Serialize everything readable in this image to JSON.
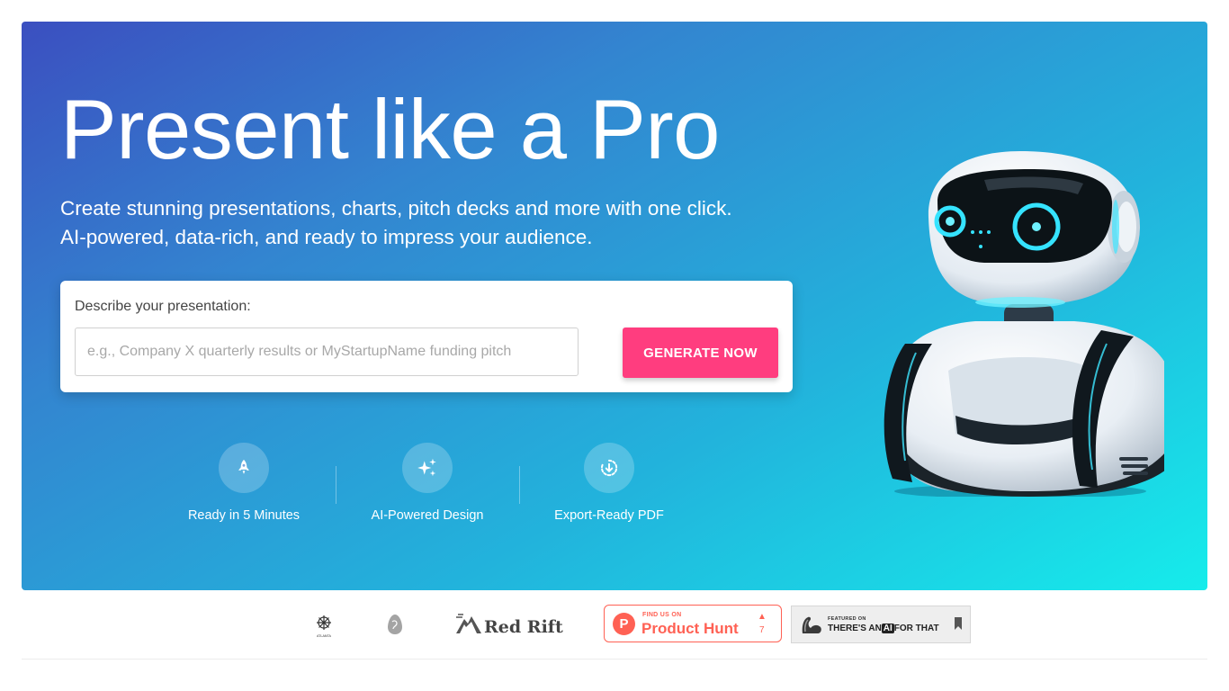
{
  "hero": {
    "title": "Present like a Pro",
    "subtitle_line1": "Create stunning presentations, charts, pitch decks and more with one click.",
    "subtitle_line2": "AI-powered, data-rich, and ready to impress your audience."
  },
  "form": {
    "label": "Describe your presentation:",
    "input_value": "",
    "input_placeholder": "e.g., Company X quarterly results or MyStartupName funding pitch",
    "button_label": "GENERATE NOW"
  },
  "features": [
    {
      "label": "Ready in 5 Minutes",
      "icon": "rocket-icon"
    },
    {
      "label": "AI-Powered Design",
      "icon": "sparkles-icon"
    },
    {
      "label": "Export-Ready PDF",
      "icon": "download-icon"
    }
  ],
  "logos": {
    "atlanta_text": "ATLANTA",
    "red_rift": "Red Rift",
    "product_hunt": {
      "small": "FIND US ON",
      "big": "Product Hunt",
      "count": "7"
    },
    "aift": {
      "small": "FEATURED ON",
      "pre": "THERE'S AN",
      "ai": "AI",
      "post": "FOR THAT"
    }
  },
  "colors": {
    "accent": "#ff3d7f",
    "product_hunt": "#ff6154",
    "gradient_start": "#3b4fc0",
    "gradient_end": "#16eceb"
  }
}
